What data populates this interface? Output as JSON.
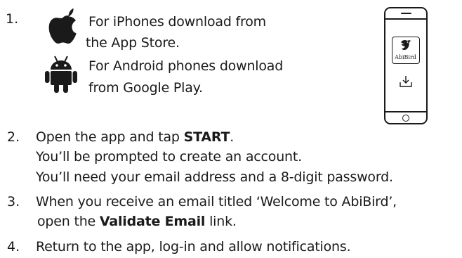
{
  "steps": [
    {
      "number": "1.",
      "ios_line1": "For iPhones download from",
      "ios_line2": "the App Store.",
      "android_line1": "For Android phones download",
      "android_line2": "from Google Play."
    },
    {
      "number": "2.",
      "line1_pre": "Open the app and tap ",
      "line1_bold": "START",
      "line1_post": ".",
      "line2": "You’ll be prompted to create an account.",
      "line3": "You’ll need your email address and a 8-digit password."
    },
    {
      "number": "3.",
      "line1": "When you receive an email titled ‘Welcome to AbiBird’,",
      "line2_pre": "open the ",
      "line2_bold": "Validate Email",
      "line2_post": " link."
    },
    {
      "number": "4.",
      "line1": "Return to the app, log-in and allow notifications."
    }
  ],
  "phone": {
    "app_name": "AbiBird"
  },
  "icons": {
    "apple": "apple-logo-icon",
    "android": "android-robot-icon",
    "bird": "bird-icon",
    "download": "download-icon"
  },
  "colors": {
    "text": "#1a1a1a",
    "background": "#ffffff"
  }
}
